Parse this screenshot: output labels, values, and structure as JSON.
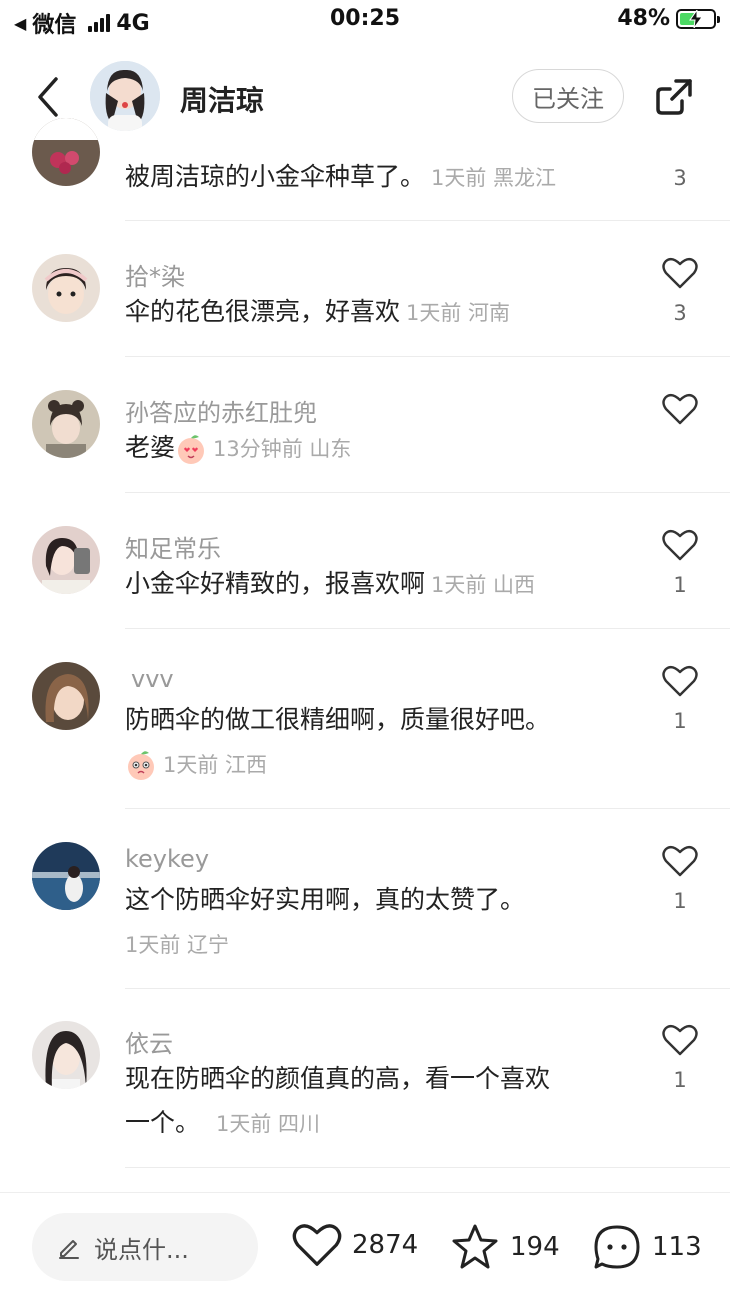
{
  "status_bar": {
    "back_app": "微信",
    "network": "4G",
    "time": "00:25",
    "battery": "48%",
    "battery_level": 0.48
  },
  "header": {
    "author": "周洁琼",
    "follow_label": "已关注"
  },
  "comments": [
    {
      "name": "",
      "text": "被周洁琼的小金伞种草了。",
      "meta": "1天前 黑龙江",
      "likes": "3"
    },
    {
      "name": "拾*染",
      "text": "伞的花色很漂亮，好喜欢",
      "meta": "1天前 河南",
      "likes": "3"
    },
    {
      "name": "孙答应的赤红肚兜",
      "text": "老婆",
      "meta": "13分钟前 山东",
      "likes": ""
    },
    {
      "name": "知足常乐",
      "text": "小金伞好精致的，报喜欢啊",
      "meta": "1天前 山西",
      "likes": "1"
    },
    {
      "name": "vvv",
      "text": "防晒伞的做工很精细啊，质量很好吧。",
      "meta": "1天前 江西",
      "likes": "1"
    },
    {
      "name": "keykey",
      "text": "这个防晒伞好实用啊，真的太赞了。",
      "meta": "1天前 辽宁",
      "likes": "1"
    },
    {
      "name": "依云",
      "text": "现在防晒伞的颜值真的高，看一个喜欢",
      "text2": "一个。",
      "meta": "1天前 四川",
      "likes": "1"
    }
  ],
  "bottom_bar": {
    "input_placeholder": "说点什...",
    "likes": "2874",
    "favorites": "194",
    "comments": "113"
  },
  "colors": {
    "accent_green": "#4cd964",
    "muted_text": "#999999"
  }
}
